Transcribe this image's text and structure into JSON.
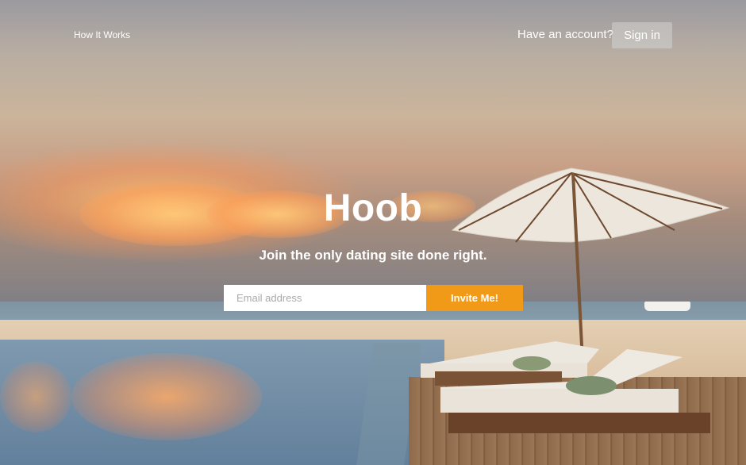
{
  "header": {
    "nav_link": "How It Works",
    "account_prompt": "Have an account?",
    "signin_label": "Sign in"
  },
  "hero": {
    "title": "Hoob",
    "subtitle": "Join the only dating site done right."
  },
  "signup": {
    "email_placeholder": "Email address",
    "email_value": "",
    "button_label": "Invite Me!"
  },
  "colors": {
    "accent": "#f09a18",
    "text": "#ffffff",
    "signin_bg": "rgba(210,210,210,0.55)"
  }
}
